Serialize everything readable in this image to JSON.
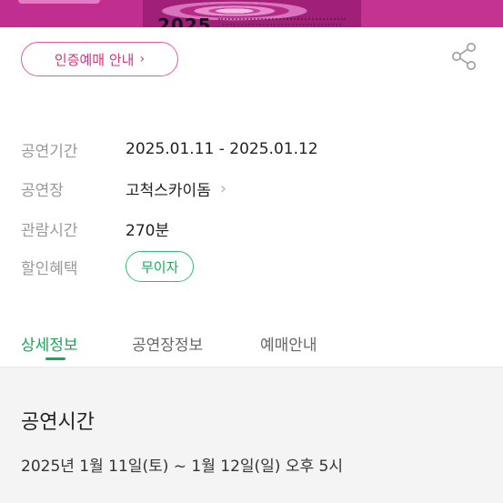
{
  "poster": {
    "year_text": "2025"
  },
  "auth_button": {
    "label": "인증예매 안내",
    "chevron": "chevron-right-icon"
  },
  "share_icon": "share-icon",
  "info": [
    {
      "label": "공연기간",
      "value": "2025.01.11 - 2025.01.12"
    },
    {
      "label": "공연장",
      "value": "고척스카이돔"
    },
    {
      "label": "관람시간",
      "value": "270분"
    },
    {
      "label": "할인혜택",
      "value": "무이자"
    }
  ],
  "tabs": [
    {
      "label": "상세정보",
      "active": true
    },
    {
      "label": "공연장정보",
      "active": false
    },
    {
      "label": "예매안내",
      "active": false
    }
  ],
  "detail": {
    "title": "공연시간",
    "text": "2025년 1월 11일(토) ~ 1월 12일(일) 오후 5시"
  },
  "colors": {
    "accent_green": "#16a957",
    "auth_pink": "#d8327f",
    "poster_pink": "#c3338f"
  }
}
